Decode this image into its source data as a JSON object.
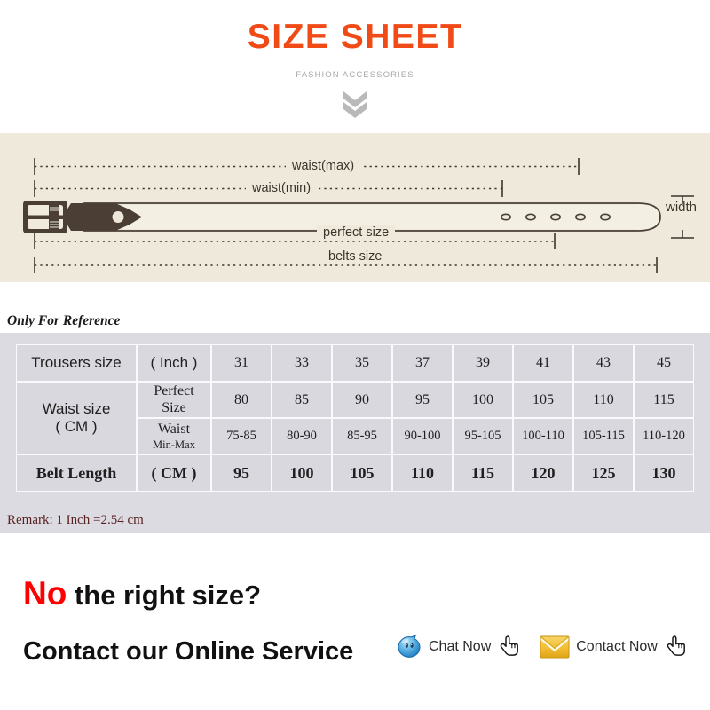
{
  "header": {
    "title": "SIZE SHEET",
    "subtitle": "FASHION ACCESSORIES",
    "chevron_icon": "double-chevron-down-icon",
    "title_color": "#F04A17",
    "subtitle_color": "#A8A8A8"
  },
  "belt_diagram": {
    "background_color": "#EFE9DC",
    "line_color": "#3D342C",
    "labels": {
      "waist_max": "waist(max)",
      "waist_min": "waist(min)",
      "perfect_size": "perfect size",
      "belts_size": "belts size",
      "width": "width"
    },
    "hole_count": 5
  },
  "reference_note": "Only For Reference",
  "table": {
    "background_color": "#DCDBE2",
    "cell_color": "#D9D8DF",
    "rows": [
      {
        "label": "Trousers size",
        "unit": "( Inch )",
        "values": [
          "31",
          "33",
          "35",
          "37",
          "39",
          "41",
          "43",
          "45"
        ]
      },
      {
        "label": "Waist size",
        "label_unit": "( CM )",
        "unit_line1": "Perfect",
        "unit_line2": "Size",
        "values": [
          "80",
          "85",
          "90",
          "95",
          "100",
          "105",
          "110",
          "115"
        ]
      },
      {
        "unit_line1": "Waist",
        "unit_line2": "Min-Max",
        "values": [
          "75-85",
          "80-90",
          "85-95",
          "90-100",
          "95-105",
          "100-110",
          "105-115",
          "110-120"
        ]
      },
      {
        "label": "Belt Length",
        "unit": "( CM )",
        "values": [
          "95",
          "100",
          "105",
          "110",
          "115",
          "120",
          "125",
          "130"
        ]
      }
    ]
  },
  "remark": "Remark: 1 Inch =2.54 cm",
  "footer": {
    "no_word": "No",
    "question": " the right size?",
    "contact_line": "Contact our Online Service",
    "chat": {
      "label": "Chat Now",
      "icon": "trademanager-chat-icon",
      "cursor_icon": "pointing-hand-icon",
      "icon_color": "#2E8FD6"
    },
    "contact": {
      "label": "Contact Now",
      "icon": "envelope-icon",
      "cursor_icon": "pointing-hand-icon",
      "icon_color": "#F0BE33"
    },
    "no_color": "#FF0000"
  }
}
